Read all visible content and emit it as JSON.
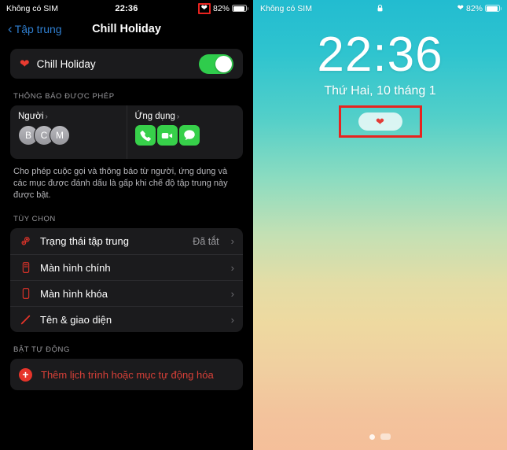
{
  "settings_screen": {
    "status_bar": {
      "carrier": "Không có SIM",
      "time": "22:36",
      "focus_icon": "heart-icon",
      "battery_percent": "82%",
      "battery_level": 82
    },
    "nav": {
      "back_label": "Tập trung",
      "back_icon": "chevron-left-icon",
      "title": "Chill Holiday"
    },
    "mode": {
      "icon": "heart-icon",
      "name": "Chill Holiday",
      "toggle_on": true
    },
    "allowed_section": {
      "header": "THÔNG BÁO ĐƯỢC PHÉP",
      "people": {
        "label": "Người",
        "chevron": "›",
        "avatars": [
          "B",
          "C",
          "M"
        ]
      },
      "apps": {
        "label": "Ứng dụng",
        "chevron": "›",
        "icons": [
          "phone-app-icon",
          "facetime-app-icon",
          "messages-app-icon"
        ]
      },
      "description": "Cho phép cuộc gọi và thông báo từ người, ứng dụng và các mục được đánh dấu là gấp khi chế độ tập trung này được bật."
    },
    "options_section": {
      "header": "TÙY CHỌN",
      "rows": [
        {
          "icon": "focus-status-icon",
          "label": "Trạng thái tập trung",
          "value": "Đã tắt",
          "chevron": "›"
        },
        {
          "icon": "home-screen-icon",
          "label": "Màn hình chính",
          "value": "",
          "chevron": "›"
        },
        {
          "icon": "lock-screen-icon",
          "label": "Màn hình khóa",
          "value": "",
          "chevron": "›"
        },
        {
          "icon": "pencil-icon",
          "label": "Tên & giao diện",
          "value": "",
          "chevron": "›"
        }
      ]
    },
    "automation_section": {
      "header": "BẬT TỰ ĐỘNG",
      "add_icon": "plus-circle-icon",
      "add_label": "Thêm lịch trình hoặc mục tự động hóa"
    }
  },
  "lock_screen": {
    "status_bar": {
      "carrier": "Không có SIM",
      "lock_icon": "lock-closed-icon",
      "focus_icon": "heart-icon",
      "battery_percent": "82%",
      "battery_level": 82
    },
    "time": "22:36",
    "date": "Thứ Hai, 10 tháng 1",
    "focus_badge": {
      "icon": "heart-icon",
      "highlighted": true
    },
    "page_indicator": {
      "dot": "•",
      "pages": 2
    }
  },
  "colors": {
    "accent_red": "#e6342a",
    "toggle_green": "#2fcc4c",
    "link_blue": "#2f7fd1",
    "highlight_box": "#e8231f",
    "card_bg": "#1b1b1d"
  }
}
